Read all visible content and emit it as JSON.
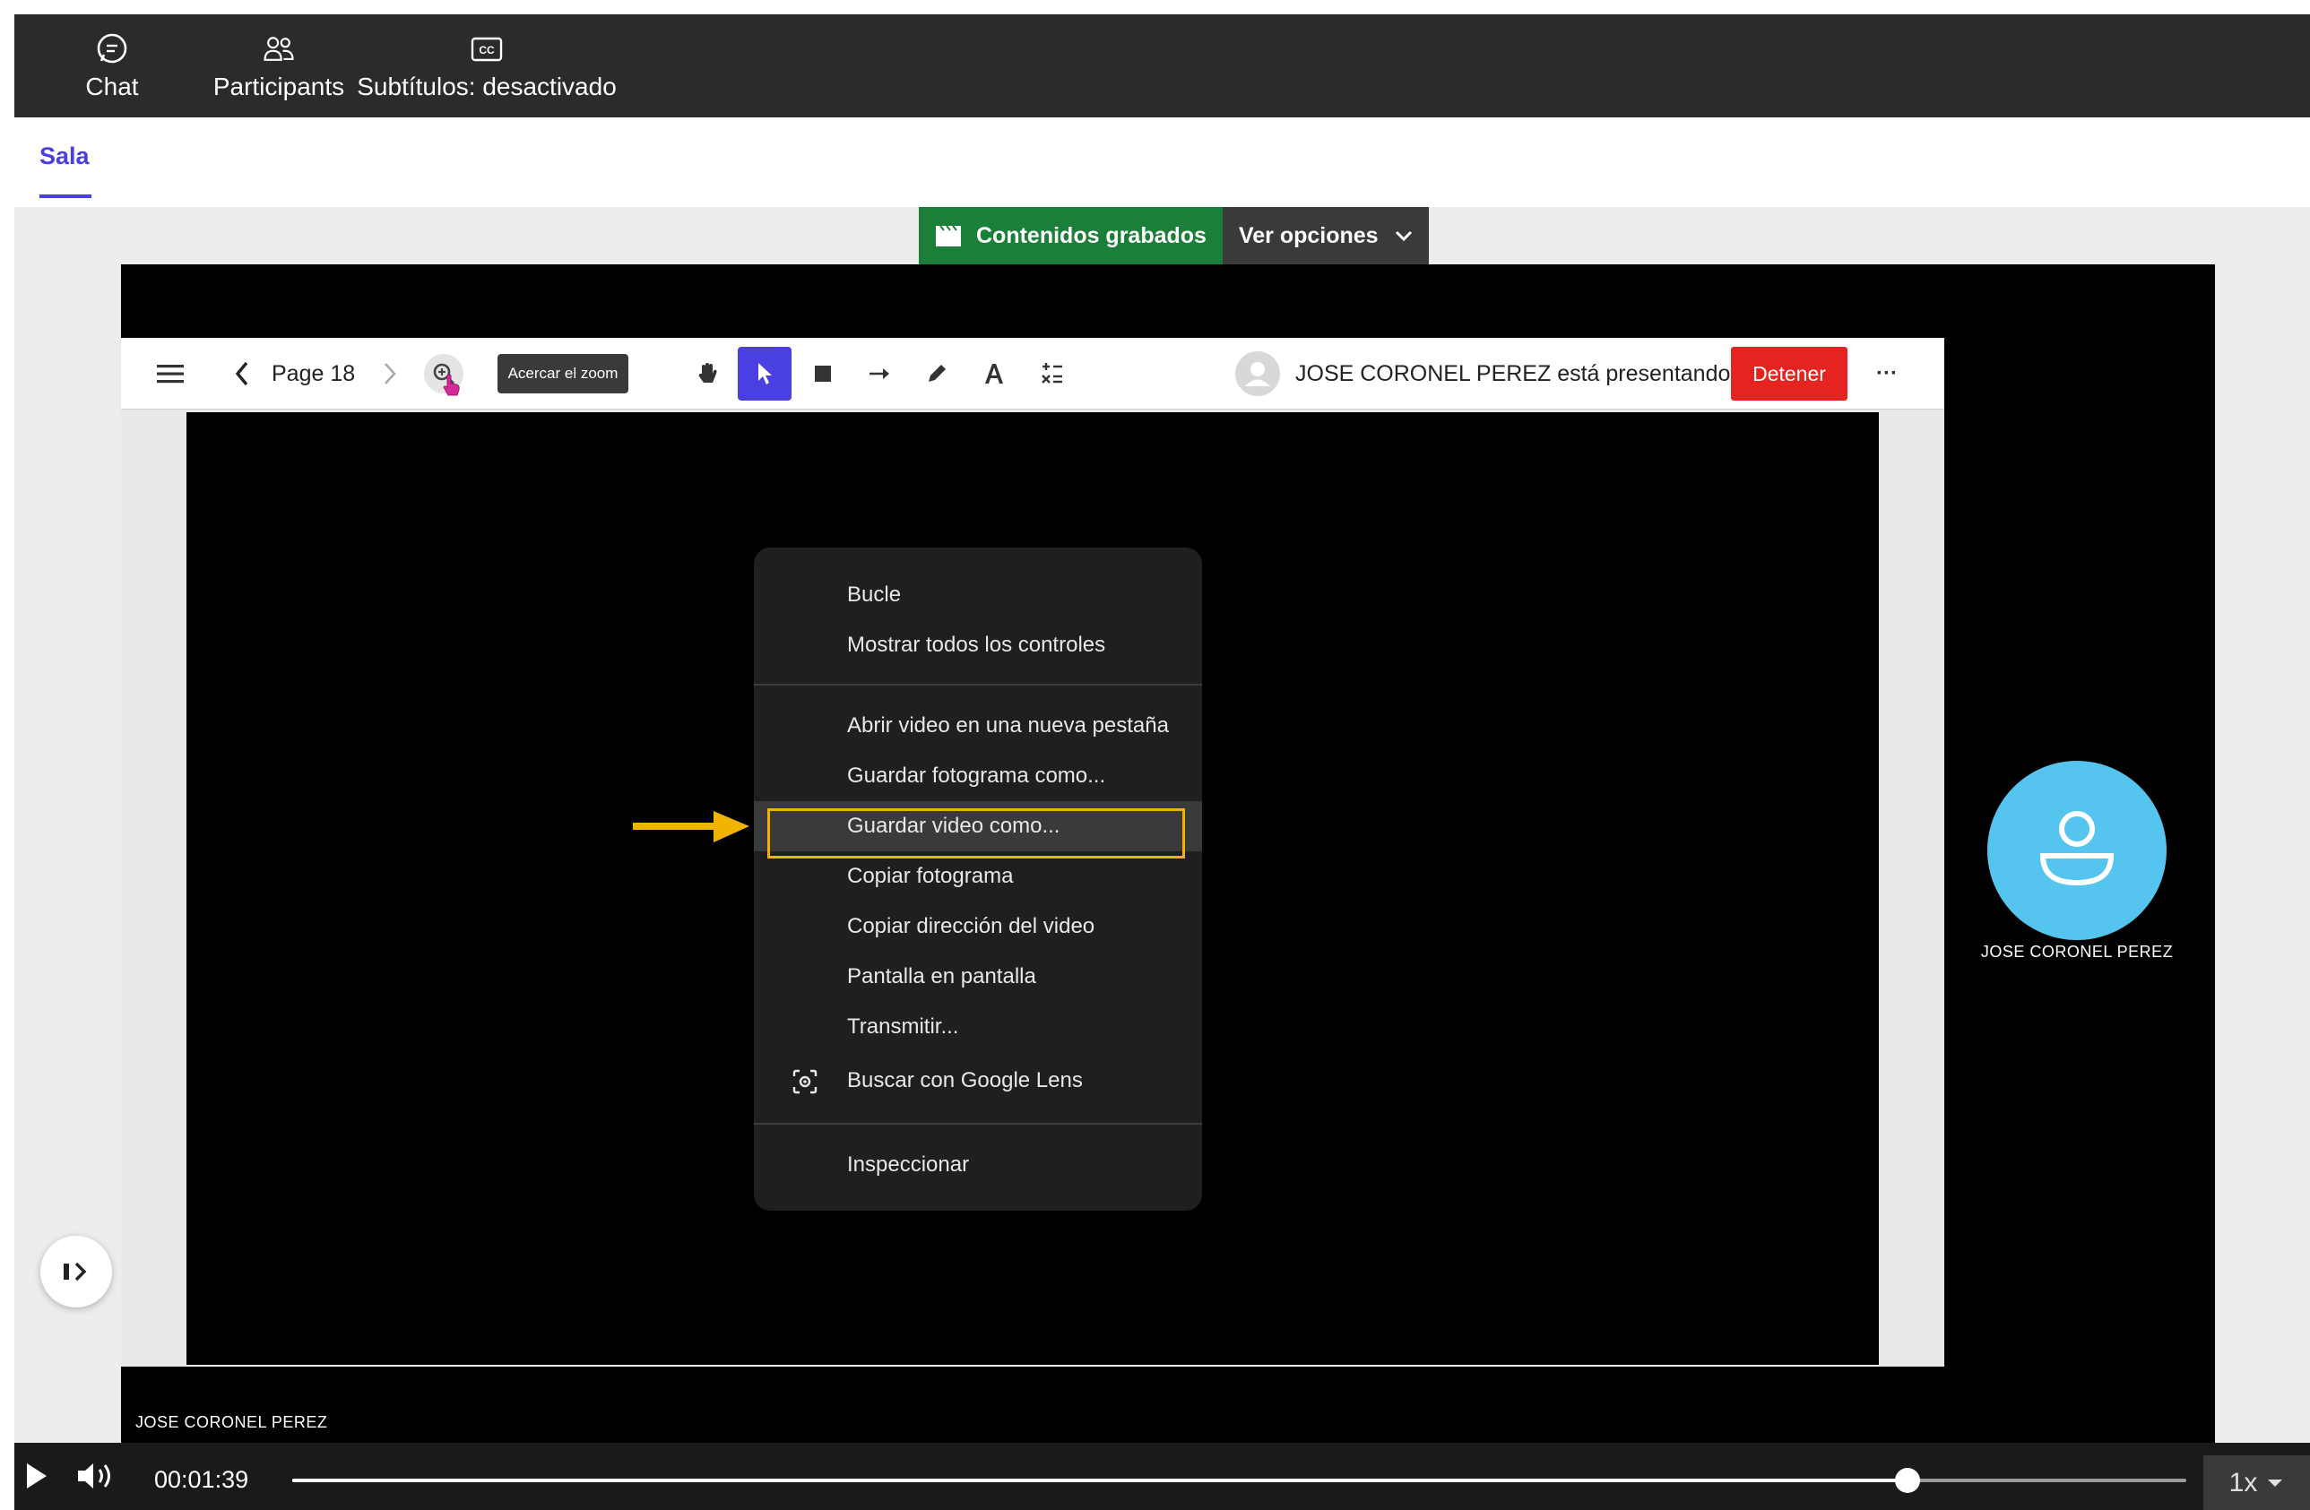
{
  "topbar": {
    "chat_label": "Chat",
    "participants_label": "Participants",
    "subtitles_label": "Subtítulos: desactivado"
  },
  "tabs": {
    "active": "Sala"
  },
  "recording": {
    "badge_label": "Contenidos grabados",
    "options_label": "Ver opciones"
  },
  "presenter_toolbar": {
    "page_label": "Page 18",
    "zoom_tooltip": "Acercar el zoom",
    "presenter_text": "JOSE CORONEL PEREZ está presentando",
    "stop_label": "Detener",
    "more_label": "···"
  },
  "context_menu": {
    "items": [
      "Bucle",
      "Mostrar todos los controles",
      "Abrir video en una nueva pestaña",
      "Guardar fotograma como...",
      "Guardar video como...",
      "Copiar fotograma",
      "Copiar dirección del video",
      "Pantalla en pantalla",
      "Transmitir...",
      "Buscar con Google Lens",
      "Inspeccionar"
    ],
    "highlighted_item": "Guardar video como..."
  },
  "participant": {
    "avatar_name": "JOSE CORONEL PEREZ",
    "bottom_name": "JOSE CORONEL PEREZ"
  },
  "player": {
    "time": "00:01:39",
    "progress_fraction": 0.853,
    "speed": "1x"
  },
  "colors": {
    "accent": "#4a3fe0",
    "recording_green": "#1b7f3a",
    "stop_red": "#e52421",
    "highlight_yellow": "#f0b400",
    "avatar_blue": "#55c4ee"
  }
}
